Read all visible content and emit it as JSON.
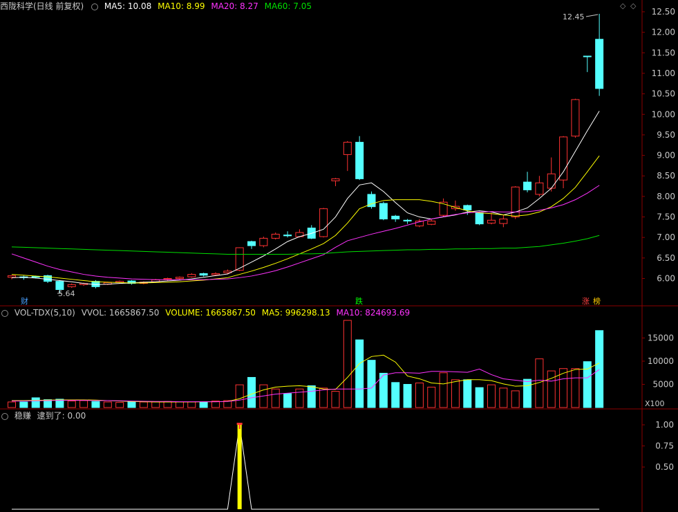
{
  "main": {
    "title": "西陇科学(日线 前复权)",
    "ma": [
      {
        "label": "MA5: 10.08",
        "color": "#ffffff"
      },
      {
        "label": "MA10: 8.99",
        "color": "#ffff00"
      },
      {
        "label": "MA20: 8.27",
        "color": "#ff33ff"
      },
      {
        "label": "MA60: 7.05",
        "color": "#00e000"
      }
    ],
    "high_label": "12.45",
    "low_label": "5.64",
    "tags": [
      {
        "text": "财",
        "color": "#4aa0ff"
      },
      {
        "text": "跌",
        "color": "#00ff00"
      },
      {
        "text": "涨",
        "color": "#ff4040"
      },
      {
        "text": "榜",
        "color": "#ffcc00"
      }
    ]
  },
  "volume_panel": {
    "name": "VOL-TDX(5,10)",
    "vvol": "VVOL: 1665867.50",
    "volume": "VOLUME: 1665867.50",
    "ma5": "MA5: 996298.13",
    "ma10": "MA10: 824693.69",
    "unit": "X100"
  },
  "indicator_panel": {
    "name": "稳赚",
    "value": "逮到了: 0.00"
  },
  "colors": {
    "up": "#ff3232",
    "down": "#54ffff",
    "grid": "#8b0000",
    "axis": "#c8c8c8"
  },
  "chart_data": [
    {
      "type": "candlestick",
      "title": "西陇科学(日线 前复权)",
      "ylim": [
        5.6,
        12.6
      ],
      "y_ticks": [
        6.0,
        6.5,
        7.0,
        7.5,
        8.0,
        8.5,
        9.0,
        9.5,
        10.0,
        10.5,
        11.0,
        11.5,
        12.0,
        12.5
      ],
      "series_fields": [
        "open",
        "close",
        "high",
        "low"
      ],
      "candles": [
        [
          6.03,
          6.07,
          6.08,
          5.98
        ],
        [
          6.04,
          6.02,
          6.07,
          5.97
        ],
        [
          6.05,
          6.03,
          6.07,
          6.0
        ],
        [
          6.07,
          5.93,
          6.09,
          5.89
        ],
        [
          5.93,
          5.73,
          5.96,
          5.64
        ],
        [
          5.8,
          5.85,
          5.88,
          5.77
        ],
        [
          5.85,
          5.88,
          5.9,
          5.82
        ],
        [
          5.93,
          5.8,
          5.96,
          5.76
        ],
        [
          5.86,
          5.9,
          5.92,
          5.84
        ],
        [
          5.9,
          5.93,
          5.95,
          5.88
        ],
        [
          5.94,
          5.88,
          5.96,
          5.85
        ],
        [
          5.88,
          5.91,
          5.93,
          5.86
        ],
        [
          5.92,
          5.97,
          5.99,
          5.9
        ],
        [
          5.98,
          6.0,
          6.02,
          5.95
        ],
        [
          6.0,
          6.03,
          6.05,
          5.97
        ],
        [
          6.04,
          6.1,
          6.13,
          6.02
        ],
        [
          6.12,
          6.08,
          6.14,
          6.05
        ],
        [
          6.09,
          6.12,
          6.15,
          6.06
        ],
        [
          6.14,
          6.18,
          6.22,
          6.1
        ],
        [
          6.2,
          6.75,
          6.76,
          6.18
        ],
        [
          6.9,
          6.8,
          6.92,
          6.72
        ],
        [
          6.8,
          6.98,
          7.02,
          6.76
        ],
        [
          6.98,
          7.08,
          7.12,
          6.95
        ],
        [
          7.06,
          7.04,
          7.15,
          7.0
        ],
        [
          7.02,
          7.12,
          7.2,
          7.0
        ],
        [
          7.23,
          6.98,
          7.3,
          6.96
        ],
        [
          7.02,
          7.7,
          7.72,
          7.0
        ],
        [
          8.38,
          8.43,
          8.45,
          8.25
        ],
        [
          9.02,
          9.32,
          9.35,
          8.62
        ],
        [
          9.32,
          8.43,
          9.47,
          8.4
        ],
        [
          8.05,
          7.75,
          8.12,
          7.7
        ],
        [
          7.83,
          7.45,
          7.87,
          7.42
        ],
        [
          7.52,
          7.45,
          7.55,
          7.38
        ],
        [
          7.42,
          7.4,
          7.45,
          7.33
        ],
        [
          7.28,
          7.4,
          7.45,
          7.25
        ],
        [
          7.32,
          7.4,
          7.45,
          7.3
        ],
        [
          7.54,
          7.86,
          7.95,
          7.5
        ],
        [
          7.7,
          7.76,
          7.9,
          7.65
        ],
        [
          7.78,
          7.67,
          7.8,
          7.55
        ],
        [
          7.6,
          7.33,
          7.63,
          7.3
        ],
        [
          7.35,
          7.42,
          7.6,
          7.32
        ],
        [
          7.34,
          7.45,
          7.55,
          7.25
        ],
        [
          7.5,
          8.23,
          8.25,
          7.45
        ],
        [
          8.35,
          8.16,
          8.6,
          8.1
        ],
        [
          8.05,
          8.33,
          8.5,
          8.0
        ],
        [
          8.2,
          8.55,
          8.95,
          8.12
        ],
        [
          8.4,
          9.45,
          9.47,
          8.2
        ],
        [
          9.47,
          10.36,
          10.38,
          9.43
        ],
        [
          11.42,
          11.41,
          11.42,
          11.03
        ],
        [
          11.83,
          10.63,
          12.45,
          10.45
        ]
      ],
      "ma_lines": [
        {
          "name": "MA5",
          "color": "#ffffff",
          "values": [
            6.02,
            6.03,
            6.01,
            5.98,
            5.95,
            5.92,
            5.88,
            5.85,
            5.86,
            5.88,
            5.89,
            5.91,
            5.92,
            5.94,
            5.96,
            5.99,
            6.03,
            6.07,
            6.11,
            6.25,
            6.4,
            6.55,
            6.72,
            6.9,
            7.02,
            7.1,
            7.2,
            7.5,
            7.95,
            8.28,
            8.33,
            8.12,
            7.85,
            7.6,
            7.5,
            7.45,
            7.5,
            7.55,
            7.62,
            7.65,
            7.62,
            7.55,
            7.62,
            7.72,
            7.95,
            8.2,
            8.6,
            9.1,
            9.6,
            10.08
          ]
        },
        {
          "name": "MA10",
          "color": "#ffff00",
          "values": [
            6.1,
            6.08,
            6.06,
            6.04,
            6.01,
            5.98,
            5.95,
            5.92,
            5.91,
            5.9,
            5.89,
            5.89,
            5.9,
            5.91,
            5.92,
            5.94,
            5.96,
            5.99,
            6.02,
            6.1,
            6.18,
            6.27,
            6.37,
            6.48,
            6.6,
            6.72,
            6.85,
            7.05,
            7.35,
            7.7,
            7.82,
            7.9,
            7.92,
            7.92,
            7.92,
            7.88,
            7.82,
            7.73,
            7.65,
            7.6,
            7.58,
            7.55,
            7.52,
            7.55,
            7.62,
            7.75,
            7.95,
            8.22,
            8.6,
            8.99
          ]
        },
        {
          "name": "MA20",
          "color": "#ff33ff",
          "values": [
            6.6,
            6.5,
            6.4,
            6.3,
            6.22,
            6.16,
            6.1,
            6.06,
            6.03,
            6.01,
            5.99,
            5.98,
            5.97,
            5.97,
            5.97,
            5.97,
            5.97,
            5.98,
            5.99,
            6.02,
            6.06,
            6.12,
            6.19,
            6.28,
            6.38,
            6.48,
            6.58,
            6.76,
            6.92,
            7.0,
            7.08,
            7.15,
            7.22,
            7.3,
            7.38,
            7.45,
            7.51,
            7.56,
            7.6,
            7.62,
            7.63,
            7.62,
            7.62,
            7.63,
            7.66,
            7.72,
            7.8,
            7.92,
            8.08,
            8.27
          ]
        },
        {
          "name": "MA60",
          "color": "#00e000",
          "values": [
            6.77,
            6.76,
            6.75,
            6.74,
            6.73,
            6.72,
            6.71,
            6.7,
            6.69,
            6.68,
            6.67,
            6.66,
            6.65,
            6.64,
            6.63,
            6.62,
            6.61,
            6.6,
            6.59,
            6.59,
            6.59,
            6.59,
            6.59,
            6.59,
            6.6,
            6.6,
            6.61,
            6.63,
            6.65,
            6.66,
            6.67,
            6.68,
            6.69,
            6.7,
            6.7,
            6.71,
            6.71,
            6.72,
            6.72,
            6.73,
            6.73,
            6.74,
            6.74,
            6.76,
            6.78,
            6.82,
            6.86,
            6.91,
            6.97,
            7.05
          ]
        }
      ]
    },
    {
      "type": "bar",
      "title": "VOL-TDX(5,10)",
      "unit": "X100",
      "y_ticks": [
        5000,
        10000,
        15000
      ],
      "ylim": [
        0,
        19000
      ],
      "series": [
        {
          "name": "VOLUME",
          "values": [
            1200,
            1200,
            2100,
            1700,
            1800,
            1400,
            1500,
            1300,
            1200,
            1100,
            1200,
            1200,
            1200,
            1300,
            1200,
            1200,
            1200,
            1400,
            1500,
            4900,
            6500,
            4900,
            4000,
            3000,
            4000,
            4700,
            4200,
            3500,
            18800,
            14600,
            10200,
            7400,
            5400,
            5000,
            5300,
            4400,
            7500,
            6000,
            6000,
            4300,
            4900,
            4200,
            3600,
            6100,
            10500,
            7900,
            8400,
            8400,
            9900,
            16600
          ]
        },
        {
          "name": "MA5",
          "values": [
            1500,
            1500,
            1550,
            1600,
            1650,
            1650,
            1650,
            1600,
            1500,
            1400,
            1300,
            1250,
            1200,
            1200,
            1200,
            1200,
            1250,
            1250,
            1300,
            1900,
            2900,
            3800,
            4400,
            4600,
            4700,
            4500,
            4000,
            3900,
            6500,
            9500,
            11000,
            11300,
            9800,
            6800,
            6200,
            5300,
            5100,
            5600,
            6000,
            6000,
            5800,
            5100,
            4600,
            4700,
            5400,
            6300,
            7400,
            8200,
            8300,
            9600
          ]
        },
        {
          "name": "MA10",
          "values": [
            1400,
            1400,
            1450,
            1500,
            1550,
            1550,
            1550,
            1500,
            1500,
            1450,
            1400,
            1350,
            1300,
            1300,
            1250,
            1250,
            1250,
            1250,
            1300,
            1600,
            2100,
            2500,
            2900,
            3100,
            3300,
            3500,
            3800,
            4000,
            4000,
            4000,
            4200,
            7000,
            7500,
            7500,
            7400,
            7800,
            7800,
            7700,
            7600,
            8300,
            7100,
            6200,
            5900,
            5600,
            5900,
            5700,
            6200,
            6400,
            6400,
            8200
          ]
        }
      ]
    },
    {
      "type": "line",
      "title": "稳赚",
      "ylim": [
        0,
        1.0
      ],
      "y_ticks": [
        0.5,
        0.75,
        1.0
      ],
      "series": [
        {
          "name": "逮到了",
          "values": [
            0,
            0,
            0,
            0,
            0,
            0,
            0,
            0,
            0,
            0,
            0,
            0,
            0,
            0,
            0,
            0,
            0,
            0,
            0,
            1,
            0,
            0,
            0,
            0,
            0,
            0,
            0,
            0,
            0,
            0,
            0,
            0,
            0,
            0,
            0,
            0,
            0,
            0,
            0,
            0,
            0,
            0,
            0,
            0,
            0,
            0,
            0,
            0,
            0,
            0
          ]
        }
      ]
    }
  ]
}
